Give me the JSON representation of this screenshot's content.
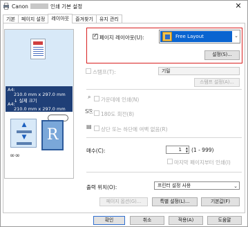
{
  "window": {
    "title_prefix": "Canon",
    "title_suffix": "인쇄 기본 설정",
    "close_glyph": "✕"
  },
  "tabs": [
    {
      "label": "기본"
    },
    {
      "label": "페이지 설정"
    },
    {
      "label": "레이아웃"
    },
    {
      "label": "즐겨찾기"
    },
    {
      "label": "유지 관리"
    }
  ],
  "preview": {
    "size_line1": "A4:",
    "size_line2": "210.0 mm x 297.0 mm",
    "size_line3": "↓ 실제 크기",
    "size_line4": "A4:",
    "size_line5": "210.0 mm x 297.0 mm",
    "paper_letter": "R"
  },
  "layout": {
    "checkbox_label": "페이지 레이아웃(U):",
    "checked": true,
    "selected_value": "Free Layout",
    "settings_button": "설정(S)..."
  },
  "stamp": {
    "checkbox_label": "스탬프(T):",
    "select_value": "기밀",
    "settings_button": "스탬프 설정(A)..."
  },
  "options": {
    "grayscale_label": "가운데에 인쇄(N)",
    "rotate_label": "180도 회전(8)",
    "margin_label": "상단 또는 하단에 여백 없음(R)"
  },
  "copies": {
    "label": "매수(C):",
    "value": "1",
    "range": "(1 - 999)",
    "reverse_label": "마지막 페이지부터 인쇄(I)"
  },
  "output": {
    "label": "출력 위치(O):",
    "value": "프린터 설정 사용"
  },
  "bottom_buttons": {
    "page_options": "페이지 옵션(G)...",
    "special_settings": "특별 설정(L)...",
    "defaults": "기본값(F)"
  },
  "dialog_buttons": {
    "ok": "확인",
    "cancel": "취소",
    "apply": "적용(A)",
    "help": "도움말"
  },
  "colors": {
    "accent_select": "#0a64d0",
    "highlight_border": "#d81e1e",
    "preview_bg": "#d8e9f8",
    "size_box": "#1f3f77"
  }
}
